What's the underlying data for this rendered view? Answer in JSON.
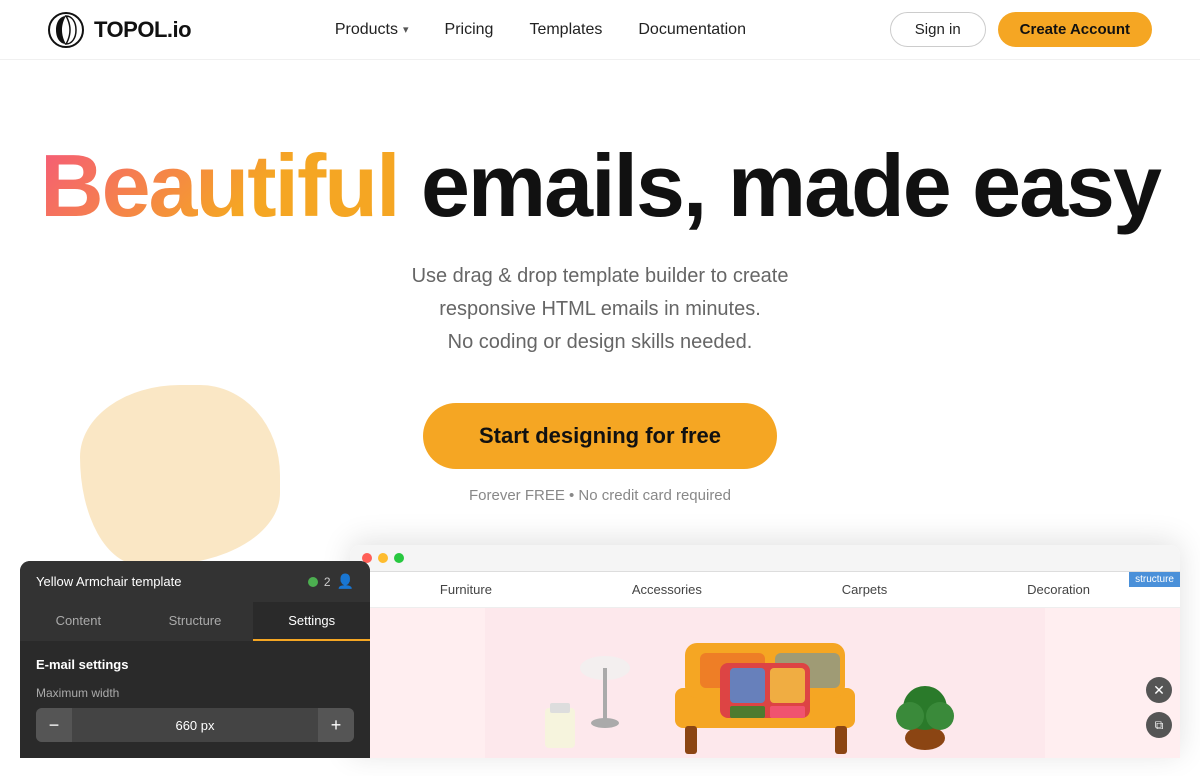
{
  "site": {
    "logo_text": "TOPOL.io"
  },
  "nav": {
    "links": [
      {
        "id": "products",
        "label": "Products",
        "has_dropdown": true
      },
      {
        "id": "pricing",
        "label": "Pricing",
        "has_dropdown": false
      },
      {
        "id": "templates",
        "label": "Templates",
        "has_dropdown": false
      },
      {
        "id": "documentation",
        "label": "Documentation",
        "has_dropdown": false
      }
    ],
    "signin_label": "Sign in",
    "create_account_label": "Create Account"
  },
  "hero": {
    "title_gradient": "Beautiful",
    "title_rest": " emails, made easy",
    "subtitle": "Use drag & drop template builder to create responsive HTML emails in minutes.\nNo coding or design skills needed.",
    "cta_label": "Start designing for free",
    "note": "Forever FREE • No credit card required"
  },
  "editor": {
    "template_name": "Yellow Armchair template",
    "user_count": "2",
    "tabs": [
      {
        "id": "content",
        "label": "Content",
        "active": false
      },
      {
        "id": "structure",
        "label": "Structure",
        "active": false
      },
      {
        "id": "settings",
        "label": "Settings",
        "active": true
      }
    ],
    "section_title": "E-mail settings",
    "field_label": "Maximum width",
    "field_value": "660 px",
    "minus_label": "−",
    "plus_label": "+"
  },
  "template_preview": {
    "nav_items": [
      "Furniture",
      "Accessories",
      "Carpets",
      "Decoration"
    ],
    "add_label": "+",
    "structure_label": "structure"
  },
  "colors": {
    "accent_yellow": "#f5a623",
    "gradient_pink": "#f5587b",
    "nav_structure_blue": "#4a90d9"
  }
}
